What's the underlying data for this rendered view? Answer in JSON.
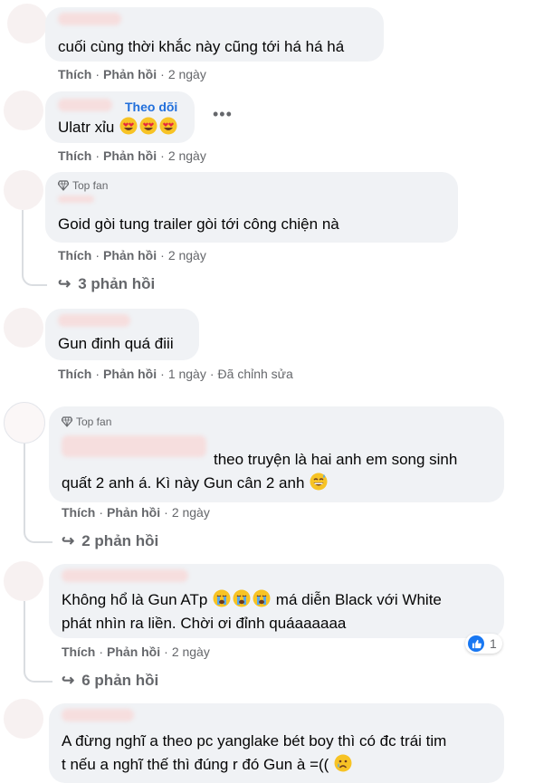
{
  "labels": {
    "like": "Thích",
    "reply": "Phản hồi",
    "dot": "·",
    "top_fan": "Top fan",
    "follow": "Theo dõi"
  },
  "comments": [
    {
      "text": "cuối cùng thời khắc này cũng tới há há há",
      "time": "2 ngày"
    },
    {
      "text": "Ulatr xỉu",
      "time": "2 ngày",
      "emoji": "heart-eyes-face x3"
    },
    {
      "text": "Goid gòi tung trailer gòi tới công chiện nà",
      "time": "2 ngày",
      "replies": "3 phản hồi"
    },
    {
      "text": "Gun đinh quá điii",
      "time": "1 ngày",
      "edited": "Đã chỉnh sửa"
    },
    {
      "line1": "theo truyện là hai anh em song sinh",
      "line2": "quất 2 anh á. Kì này Gun cân 2 anh",
      "time": "2 ngày",
      "replies": "2 phản hồi",
      "emoji": "grinning-sweat-face"
    },
    {
      "line1_a": "Không hổ là Gun ATp",
      "line1_b": "má diễn Black với White",
      "line2": "phát nhìn ra liền. Chời ơi đỉnh quáaaaaaa",
      "time": "2 ngày",
      "replies": "6 phản hồi",
      "reactions": "1",
      "emoji": "crying-face x3"
    },
    {
      "line1": "A đừng nghĩ a theo pc yanglake bét boy thì có đc trái tim",
      "line2": "t nếu a nghĩ thế thì đúng r đó Gun à =((",
      "emoji": "sad-tear-face"
    }
  ]
}
